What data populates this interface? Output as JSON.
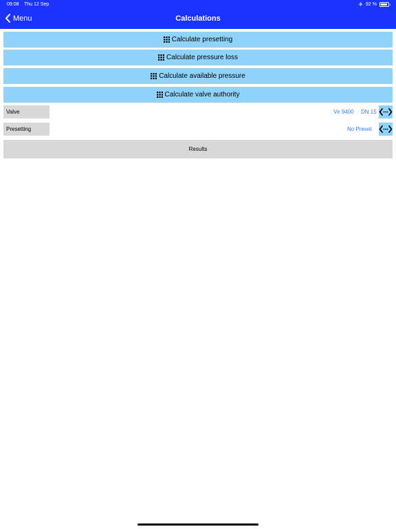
{
  "status_bar": {
    "time": "09:08",
    "date": "Thu 12 Sep",
    "battery": "92 %",
    "battery_level": 0.92,
    "airplane_icon": "airplane-icon"
  },
  "nav": {
    "back_label": "Menu",
    "title": "Calculations",
    "back_icon": "chevron-left-icon"
  },
  "calc_buttons": [
    {
      "label": "Calculate presetting",
      "icon": "grid-icon"
    },
    {
      "label": "Calculate pressure loss",
      "icon": "grid-icon"
    },
    {
      "label": "Calculate available pressure",
      "icon": "grid-icon"
    },
    {
      "label": "Calculate valve authority",
      "icon": "grid-icon"
    }
  ],
  "fields": {
    "valve": {
      "label": "Valve",
      "model": "Vir 9400",
      "size": "DN 15",
      "icon": "double-arrow-icon"
    },
    "presetting": {
      "label": "Presetting",
      "value": "No Preset",
      "icon": "double-arrow-icon"
    }
  },
  "results": {
    "label": "Results"
  },
  "colors": {
    "header_bg": "#1a33ff",
    "button_bg": "#8fd3fb",
    "label_bg": "#d8d8d8",
    "value_text": "#3477f6"
  }
}
